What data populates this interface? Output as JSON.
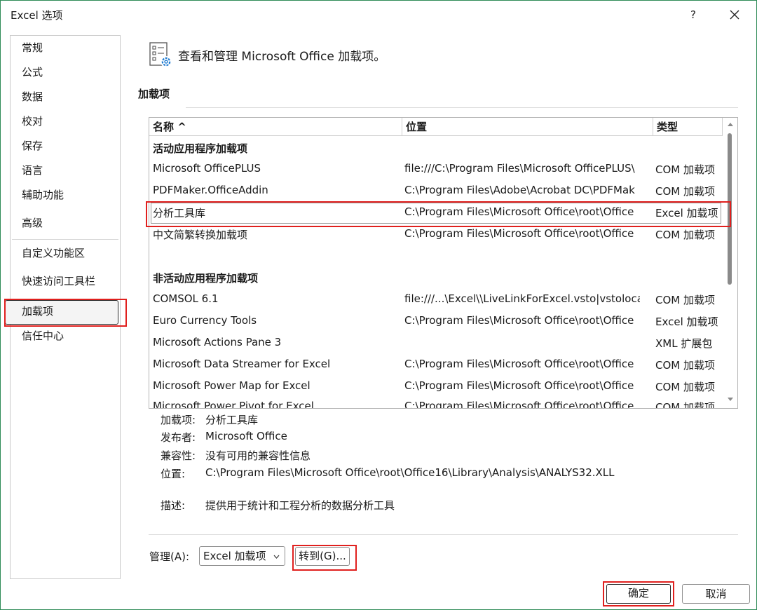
{
  "window": {
    "title": "Excel 选项",
    "help_label": "?"
  },
  "nav": {
    "items": [
      {
        "label": "常规"
      },
      {
        "label": "公式"
      },
      {
        "label": "数据"
      },
      {
        "label": "校对"
      },
      {
        "label": "保存"
      },
      {
        "label": "语言"
      },
      {
        "label": "辅助功能"
      },
      {
        "label": "高级"
      },
      {
        "label": "自定义功能区"
      },
      {
        "label": "快速访问工具栏"
      },
      {
        "label": "加载项"
      },
      {
        "label": "信任中心"
      }
    ],
    "selected": "加载项"
  },
  "main": {
    "heading": "查看和管理 Microsoft Office 加载项。",
    "section_title": "加载项"
  },
  "grid": {
    "columns": {
      "name": "名称 ^",
      "location": "位置",
      "type": "类型"
    },
    "active_group": "活动应用程序加载项",
    "active_rows": [
      {
        "name": "Microsoft OfficePLUS",
        "location": "file:///C:\\Program Files\\Microsoft OfficePLUS\\",
        "type": "COM 加载项"
      },
      {
        "name": "PDFMaker.OfficeAddin",
        "location": "C:\\Program Files\\Adobe\\Acrobat DC\\PDFMak",
        "type": "COM 加载项"
      },
      {
        "name": "分析工具库",
        "location": "C:\\Program Files\\Microsoft Office\\root\\Office",
        "type": "Excel 加载项"
      },
      {
        "name": "中文简繁转换加载项",
        "location": "C:\\Program Files\\Microsoft Office\\root\\Office",
        "type": "COM 加载项"
      }
    ],
    "inactive_group": "非活动应用程序加载项",
    "inactive_rows": [
      {
        "name": "COMSOL 6.1",
        "location": "file:///...\\Excel\\\\LiveLinkForExcel.vsto|vstolocal",
        "type": "COM 加载项"
      },
      {
        "name": "Euro Currency Tools",
        "location": "C:\\Program Files\\Microsoft Office\\root\\Office",
        "type": "Excel 加载项"
      },
      {
        "name": "Microsoft Actions Pane 3",
        "location": "",
        "type": "XML 扩展包"
      },
      {
        "name": "Microsoft Data Streamer for Excel",
        "location": "C:\\Program Files\\Microsoft Office\\root\\Office",
        "type": "COM 加载项"
      },
      {
        "name": "Microsoft Power Map for Excel",
        "location": "C:\\Program Files\\Microsoft Office\\root\\Office",
        "type": "COM 加载项"
      },
      {
        "name": "Microsoft Power Pivot for Excel",
        "location": "C:\\Program Files\\Microsoft Office\\root\\Office",
        "type": "COM 加载项"
      }
    ]
  },
  "details": {
    "addin_label": "加载项:",
    "addin_value": "分析工具库",
    "publisher_label": "发布者:",
    "publisher_value": "Microsoft Office",
    "compat_label": "兼容性:",
    "compat_value": "没有可用的兼容性信息",
    "location_label": "位置:",
    "location_value": "C:\\Program Files\\Microsoft Office\\root\\Office16\\Library\\Analysis\\ANALYS32.XLL",
    "desc_label": "描述:",
    "desc_value": "提供用于统计和工程分析的数据分析工具"
  },
  "manage": {
    "label": "管理(A):",
    "selected": "Excel 加载项",
    "go_button": "转到(G)..."
  },
  "footer": {
    "ok": "确定",
    "cancel": "取消"
  },
  "colors": {
    "window_border": "#2e8b57",
    "highlight_box": "#e0201e",
    "icon_blue": "#1f7bd1"
  }
}
